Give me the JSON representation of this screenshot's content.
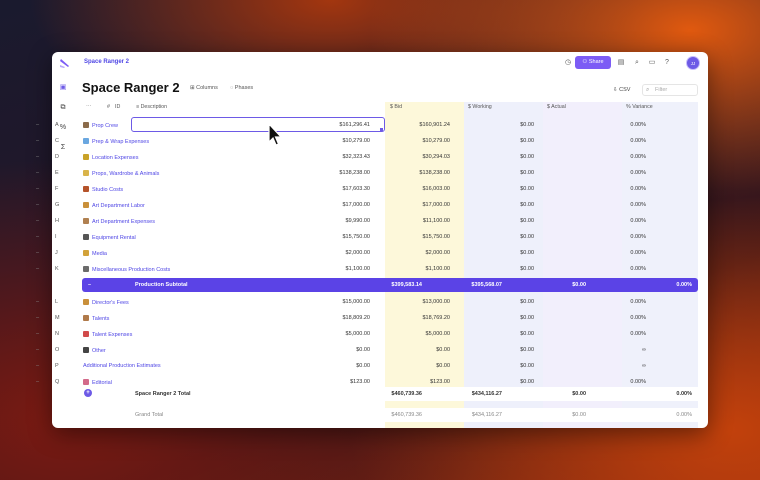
{
  "topbar": {
    "breadcrumb": "Space Ranger 2",
    "share_label": "Share",
    "avatar_initials": "JJ"
  },
  "page": {
    "title": "Space Ranger 2",
    "columns_link": "Columns",
    "phases_link": "Phases",
    "csv_label": "CSV",
    "filter_placeholder": "Filter"
  },
  "columns": {
    "num": "#",
    "id": "ID",
    "description": "Description",
    "bid": "Bid",
    "working": "Working",
    "actual": "Actual",
    "variance": "Variance"
  },
  "rows": [
    {
      "dash": "–",
      "id": "A",
      "desc": "Prop Crew",
      "bid": "$161,296.41",
      "work": "$160,901.24",
      "act": "$0.00",
      "var": "0.00%",
      "color": "#8b6b4a"
    },
    {
      "dash": "–",
      "id": "C",
      "desc": "Prep & Wrap Expenses",
      "bid": "$10,279.00",
      "work": "$10,279.00",
      "act": "$0.00",
      "var": "0.00%",
      "color": "#6aa7e0"
    },
    {
      "dash": "–",
      "id": "D",
      "desc": "Location Expenses",
      "bid": "$32,323.43",
      "work": "$30,294.03",
      "act": "$0.00",
      "var": "0.00%",
      "color": "#c9a227"
    },
    {
      "dash": "–",
      "id": "E",
      "desc": "Props, Wardrobe & Animals",
      "bid": "$138,238.00",
      "work": "$138,238.00",
      "act": "$0.00",
      "var": "0.00%",
      "color": "#d9b44a"
    },
    {
      "dash": "–",
      "id": "F",
      "desc": "Studio Costs",
      "bid": "$17,603.30",
      "work": "$16,003.00",
      "act": "$0.00",
      "var": "0.00%",
      "color": "#b5532a"
    },
    {
      "dash": "–",
      "id": "G",
      "desc": "Art Department Labor",
      "bid": "$17,000.00",
      "work": "$17,000.00",
      "act": "$0.00",
      "var": "0.00%",
      "color": "#c9903a"
    },
    {
      "dash": "–",
      "id": "H",
      "desc": "Art Department Expenses",
      "bid": "$9,990.00",
      "work": "$11,100.00",
      "act": "$0.00",
      "var": "0.00%",
      "color": "#b08050"
    },
    {
      "dash": "–",
      "id": "I",
      "desc": "Equipment Rental",
      "bid": "$15,750.00",
      "work": "$15,750.00",
      "act": "$0.00",
      "var": "0.00%",
      "color": "#555555"
    },
    {
      "dash": "–",
      "id": "J",
      "desc": "Media",
      "bid": "$2,000.00",
      "work": "$2,000.00",
      "act": "$0.00",
      "var": "0.00%",
      "color": "#d2a23a"
    },
    {
      "dash": "–",
      "id": "K",
      "desc": "Miscellaneous Production Costs",
      "bid": "$1,100.00",
      "work": "$1,100.00",
      "act": "$0.00",
      "var": "0.00%",
      "color": "#6b6b6b"
    }
  ],
  "subtotal": {
    "dash": "–",
    "label": "Production Subtotal",
    "bid": "$399,583.14",
    "work": "$395,568.07",
    "act": "$0.00",
    "var": "0.00%"
  },
  "rows2": [
    {
      "dash": "–",
      "id": "L",
      "desc": "Director's Fees",
      "bid": "$15,000.00",
      "work": "$13,000.00",
      "act": "$0.00",
      "var": "0.00%",
      "color": "#c9903a"
    },
    {
      "dash": "–",
      "id": "M",
      "desc": "Talents",
      "bid": "$18,809.20",
      "work": "$18,769.20",
      "act": "$0.00",
      "var": "0.00%",
      "color": "#b07a4a"
    },
    {
      "dash": "–",
      "id": "N",
      "desc": "Talent Expenses",
      "bid": "$5,000.00",
      "work": "$5,000.00",
      "act": "$0.00",
      "var": "0.00%",
      "color": "#d14a4a"
    },
    {
      "dash": "–",
      "id": "O",
      "desc": "Other",
      "bid": "$0.00",
      "work": "$0.00",
      "act": "$0.00",
      "var": "∞",
      "color": "#444444"
    },
    {
      "dash": "–",
      "id": "P",
      "desc": "Additional Production Estimates",
      "bid": "$0.00",
      "work": "$0.00",
      "act": "$0.00",
      "var": "∞",
      "color": ""
    },
    {
      "dash": "–",
      "id": "Q",
      "desc": "Editorial",
      "bid": "$123.00",
      "work": "$123.00",
      "act": "$0.00",
      "var": "0.00%",
      "color": "#d36a8a"
    }
  ],
  "total": {
    "label": "Space Ranger 2 Total",
    "bid": "$460,739.36",
    "work": "$434,116.27",
    "act": "$0.00",
    "var": "0.00%"
  },
  "grand": {
    "label": "Grand Total",
    "bid": "$460,739.36",
    "work": "$434,116.27",
    "act": "$0.00",
    "var": "0.00%"
  },
  "colors": {
    "accent": "#5b43e6",
    "bid_col": "#fdf7d8",
    "work_col": "#eef0fb",
    "act_col": "#f1eefb",
    "var_col": "#eef0fb"
  }
}
